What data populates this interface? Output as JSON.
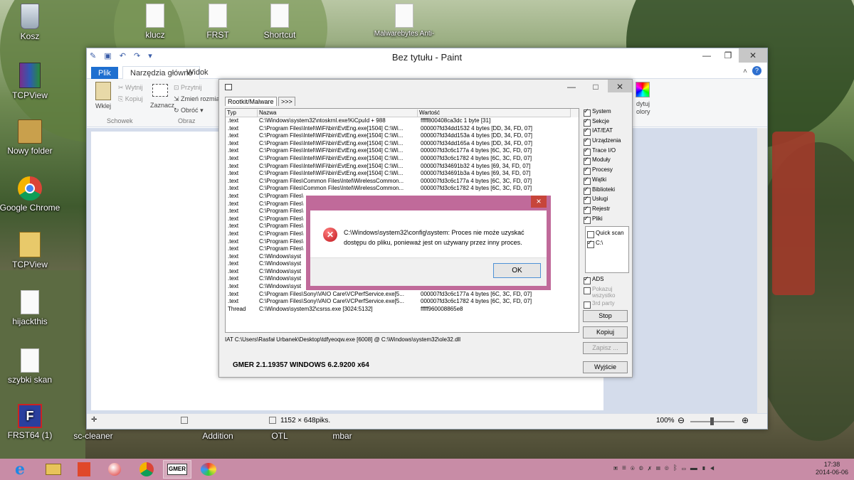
{
  "desktop": {
    "icons": [
      {
        "label": "Kosz",
        "icon": "recycle-bin-icon"
      },
      {
        "label": "TCPView",
        "icon": "winrar-icon"
      },
      {
        "label": "Nowy folder",
        "icon": "folder-icon"
      },
      {
        "label": "Google Chrome",
        "icon": "chrome-icon"
      },
      {
        "label": "TCPView",
        "icon": "tcpview-icon"
      },
      {
        "label": "hijackthis",
        "icon": "document-icon"
      },
      {
        "label": "szybki skan",
        "icon": "document-icon"
      },
      {
        "label": "FRST64 (1)",
        "icon": "frst-icon"
      },
      {
        "label": "klucz",
        "icon": "document-icon"
      },
      {
        "label": "FRST",
        "icon": "document-icon"
      },
      {
        "label": "Shortcut",
        "icon": "document-icon"
      },
      {
        "label": "Malwarebytes Anti-Malware",
        "icon": "document-icon"
      },
      {
        "label": "sc-cleaner",
        "icon": "document-icon"
      },
      {
        "label": "Addition",
        "icon": "document-icon"
      },
      {
        "label": "OTL",
        "icon": "document-icon"
      },
      {
        "label": "mbar",
        "icon": "document-icon"
      }
    ]
  },
  "paint": {
    "title": "Bez tytułu - Paint",
    "tabs": {
      "file": "Plik",
      "home": "Narzędzia główne",
      "view": "Widok"
    },
    "clipboard": {
      "paste": "Wklej",
      "cut": "Wytnij",
      "copy": "Kopiuj",
      "group": "Schowek"
    },
    "image": {
      "select": "Zaznacz",
      "crop": "Przytnij",
      "resize": "Zmień rozmia",
      "rotate": "Obróć",
      "group": "Obraz"
    },
    "colors": {
      "edit_line1": "dytuj",
      "edit_line2": "olory"
    },
    "status": {
      "size": "1152 × 648piks.",
      "zoom": "100%"
    }
  },
  "gmer": {
    "tabs": [
      "Rootkit/Malware",
      ">>>"
    ],
    "columns": [
      "Typ",
      "Nazwa",
      "Wartość"
    ],
    "rows": [
      [
        ".text",
        "C:\\Windows\\system32\\ntoskrnl.exe!KiCpuId + 988",
        "fffff800408ca3dc 1 byte [31]"
      ],
      [
        ".text",
        "C:\\Program Files\\Intel\\WiFi\\bin\\EvtEng.exe[1504] C:\\Wi...",
        "000007fd34dd1532 4 bytes [DD, 34, FD, 07]"
      ],
      [
        ".text",
        "C:\\Program Files\\Intel\\WiFi\\bin\\EvtEng.exe[1504] C:\\Wi...",
        "000007fd34dd153a 4 bytes [DD, 34, FD, 07]"
      ],
      [
        ".text",
        "C:\\Program Files\\Intel\\WiFi\\bin\\EvtEng.exe[1504] C:\\Wi...",
        "000007fd34dd165a 4 bytes [DD, 34, FD, 07]"
      ],
      [
        ".text",
        "C:\\Program Files\\Intel\\WiFi\\bin\\EvtEng.exe[1504] C:\\Wi...",
        "000007fd3c6c177a 4 bytes [6C, 3C, FD, 07]"
      ],
      [
        ".text",
        "C:\\Program Files\\Intel\\WiFi\\bin\\EvtEng.exe[1504] C:\\Wi...",
        "000007fd3c6c1782 4 bytes [6C, 3C, FD, 07]"
      ],
      [
        ".text",
        "C:\\Program Files\\Intel\\WiFi\\bin\\EvtEng.exe[1504] C:\\Wi...",
        "000007fd34691b32 4 bytes [69, 34, FD, 07]"
      ],
      [
        ".text",
        "C:\\Program Files\\Intel\\WiFi\\bin\\EvtEng.exe[1504] C:\\Wi...",
        "000007fd34691b3a 4 bytes [69, 34, FD, 07]"
      ],
      [
        ".text",
        "C:\\Program Files\\Common Files\\Intel\\WirelessCommon...",
        "000007fd3c6c177a 4 bytes [6C, 3C, FD, 07]"
      ],
      [
        ".text",
        "C:\\Program Files\\Common Files\\Intel\\WirelessCommon...",
        "000007fd3c6c1782 4 bytes [6C, 3C, FD, 07]"
      ],
      [
        ".text",
        "C:\\Program Files\\",
        ""
      ],
      [
        ".text",
        "C:\\Program Files\\",
        ""
      ],
      [
        ".text",
        "C:\\Program Files\\",
        ""
      ],
      [
        ".text",
        "C:\\Program Files\\",
        ""
      ],
      [
        ".text",
        "C:\\Program Files\\",
        ""
      ],
      [
        ".text",
        "C:\\Program Files\\",
        ""
      ],
      [
        ".text",
        "C:\\Program Files\\",
        ""
      ],
      [
        ".text",
        "C:\\Program Files\\",
        ""
      ],
      [
        ".text",
        "C:\\Windows\\syst",
        ""
      ],
      [
        ".text",
        "C:\\Windows\\syst",
        ""
      ],
      [
        ".text",
        "C:\\Windows\\syst",
        ""
      ],
      [
        ".text",
        "C:\\Windows\\syst",
        ""
      ],
      [
        ".text",
        "C:\\Windows\\syst",
        ""
      ],
      [
        ".text",
        "C:\\Program Files\\Sony\\VAIO Care\\VCPerfService.exe[5...",
        "000007fd3c6c177a 4 bytes [6C, 3C, FD, 07]"
      ],
      [
        ".text",
        "C:\\Program Files\\Sony\\VAIO Care\\VCPerfService.exe[5...",
        "000007fd3c6c1782 4 bytes [6C, 3C, FD, 07]"
      ],
      [
        "Thread",
        "C:\\Windows\\system32\\csrss.exe [3024:5132]",
        "fffff960008865e8"
      ]
    ],
    "iat_line": "IAT C:\\Users\\Rasfał Urbanek\\Desktop\\tdfyeoqw.exe [6008] @ C:\\Windows\\system32\\ole32.dll",
    "version": "GMER 2.1.19357    WINDOWS 6.2.9200  x64",
    "options": [
      {
        "label": "System",
        "checked": true
      },
      {
        "label": "Sekcje",
        "checked": true
      },
      {
        "label": "IAT/EAT",
        "checked": true
      },
      {
        "label": "Urządzenia",
        "checked": true
      },
      {
        "label": "Trace I/O",
        "checked": true
      },
      {
        "label": "Moduły",
        "checked": true
      },
      {
        "label": "Procesy",
        "checked": true
      },
      {
        "label": "Wątki",
        "checked": true
      },
      {
        "label": "Biblioteki",
        "checked": true
      },
      {
        "label": "Usługi",
        "checked": true
      },
      {
        "label": "Rejestr",
        "checked": true
      },
      {
        "label": "Pliki",
        "checked": true
      }
    ],
    "files": {
      "quick_scan": "Quick scan",
      "drive": "C:\\"
    },
    "ads": "ADS",
    "show_all": "Pokazuj wszystko",
    "third_party": "3rd party",
    "buttons": {
      "stop": "Stop",
      "copy": "Kopiuj",
      "save": "Zapisz ...",
      "exit": "Wyjście"
    }
  },
  "dialog": {
    "message": "C:\\Windows\\system32\\config\\system: Proces nie może uzyskać dostępu do pliku, ponieważ jest on używany przez inny proces.",
    "ok": "OK",
    "close": "×"
  },
  "taskbar": {
    "time": "17:38",
    "date": "2014-06-06",
    "gmer_label": "GMER"
  }
}
